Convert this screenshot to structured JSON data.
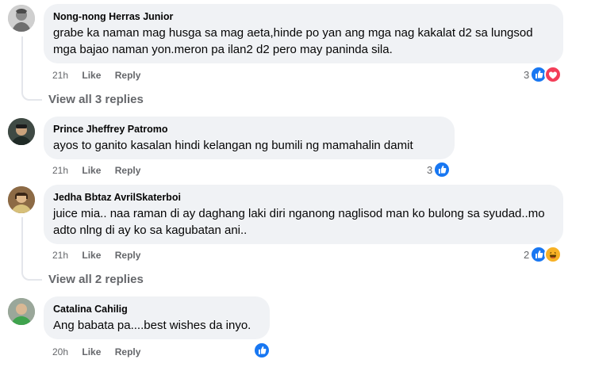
{
  "comments": [
    {
      "author": "Nong-nong Herras Junior",
      "text": "grabe ka naman mag husga sa mag aeta,hinde po yan ang mga nag kakalat d2 sa lungsod mga bajao naman yon.meron pa ilan2 d2 pero may paninda sila.",
      "time": "21h",
      "like": "Like",
      "reply": "Reply",
      "reaction_count": "3",
      "reactions": [
        "like-icon",
        "love-icon"
      ],
      "view_replies": "View all 3 replies"
    },
    {
      "author": "Prince Jheffrey Patromo",
      "text": "ayos to ganito kasalan hindi kelangan ng bumili ng mamahalin damit",
      "time": "21h",
      "like": "Like",
      "reply": "Reply",
      "reaction_count": "3",
      "reactions": [
        "like-icon"
      ]
    },
    {
      "author": "Jedha Bbtaz AvrilSkaterboi",
      "text": "juice mia.. naa raman di ay daghang laki diri nganong naglisod man ko bulong sa syudad..mo adto nlng di ay ko sa kagubatan ani..",
      "time": "21h",
      "like": "Like",
      "reply": "Reply",
      "reaction_count": "2",
      "reactions": [
        "like-icon",
        "haha-icon"
      ],
      "view_replies": "View all 2 replies"
    },
    {
      "author": "Catalina Cahilig",
      "text": "Ang babata pa....best wishes da inyo.",
      "time": "20h",
      "like": "Like",
      "reply": "Reply",
      "reaction_count": "",
      "reactions": [
        "like-icon"
      ]
    }
  ],
  "colors": {
    "bubble": "#f0f2f5",
    "meta_text": "#65676b",
    "like_blue": "#1877f2",
    "love_red": "#f33e58",
    "haha_yellow": "#f7b125"
  }
}
